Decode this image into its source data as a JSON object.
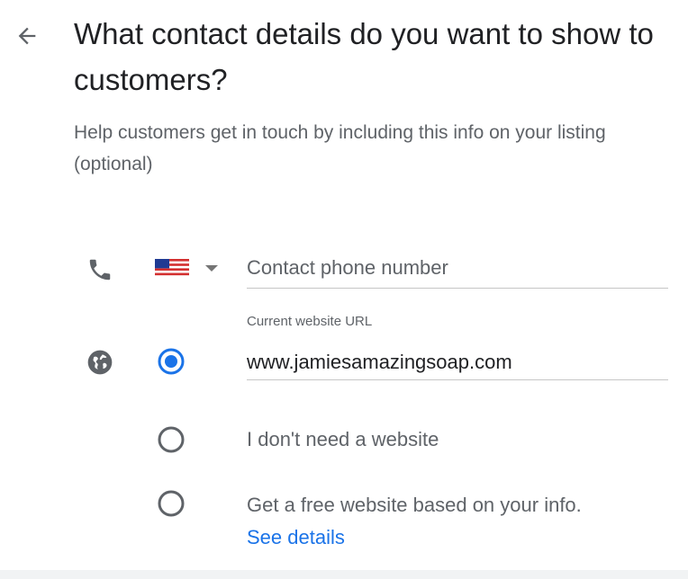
{
  "header": {
    "back_icon": "arrow-back-icon",
    "title": "What contact details do you want to show to customers?",
    "subtitle": "Help customers get in touch by including this info on your listing (optional)"
  },
  "phone": {
    "icon": "phone-icon",
    "country_flag": "us-flag",
    "placeholder": "Contact phone number",
    "value": ""
  },
  "website": {
    "icon": "globe-icon",
    "label": "Current website URL",
    "value": "www.jamiesamazingsoap.com",
    "options": [
      {
        "id": "current",
        "selected": true
      },
      {
        "id": "none",
        "label": "I don't need a website",
        "selected": false
      },
      {
        "id": "free",
        "label": "Get a free website based on your info.",
        "selected": false
      }
    ],
    "see_details_link": "See details"
  },
  "colors": {
    "accent": "#1a73e8",
    "text_primary": "#202124",
    "text_secondary": "#5f6368",
    "icon": "#5f6368"
  }
}
